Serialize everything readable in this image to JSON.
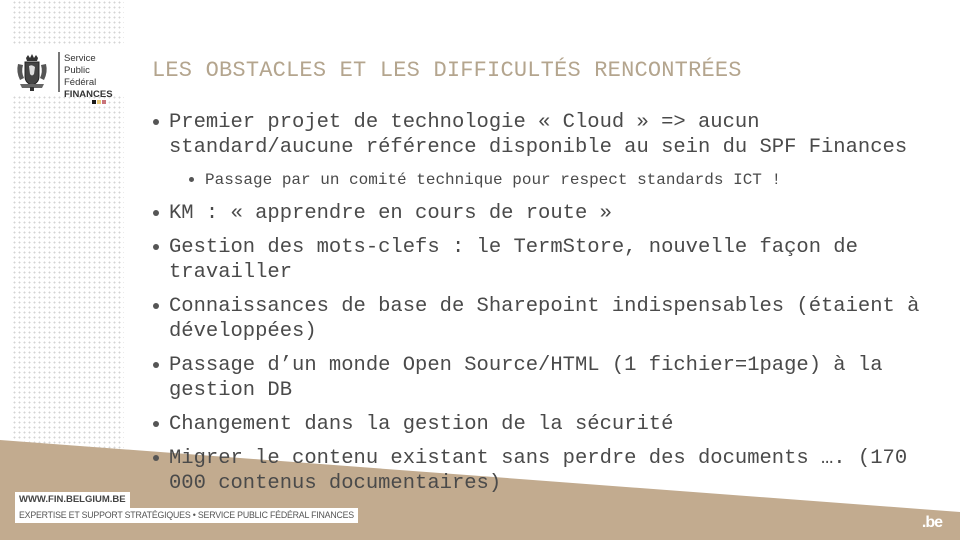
{
  "brand": {
    "org_line1": "Service Public",
    "org_line2": "Fédéral",
    "org_line3": "FINANCES",
    "flag_colors": [
      "#1a1a1a",
      "#e8c97a",
      "#c8737a"
    ],
    "accent_color": "#c2ab8f"
  },
  "slide": {
    "title": "LES OBSTACLES ET LES DIFFICULTÉS RENCONTRÉES",
    "bullets": [
      {
        "text": "Premier projet de technologie « Cloud » => aucun standard/aucune référence disponible au sein du SPF Finances",
        "sub": [
          "Passage par un comité technique pour respect standards ICT !"
        ]
      },
      {
        "text": "KM : « apprendre en cours de route »"
      },
      {
        "text": "Gestion des mots-clefs : le TermStore, nouvelle façon de travailler"
      },
      {
        "text": "Connaissances de base de Sharepoint indispensables (étaient à développées)"
      },
      {
        "text": "Passage d’un monde Open Source/HTML (1 fichier=1page) à la gestion DB"
      },
      {
        "text": "Changement dans la gestion de la sécurité"
      },
      {
        "text": "Migrer le contenu existant sans perdre des documents …. (170 000 contenus documentaires)"
      }
    ]
  },
  "footer": {
    "url": "WWW.FIN.BELGIUM.BE",
    "tagline": "EXPERTISE ET SUPPORT STRATÉGIQUES • SERVICE PUBLIC FÉDÉRAL FINANCES",
    "be_mark": ".be"
  }
}
